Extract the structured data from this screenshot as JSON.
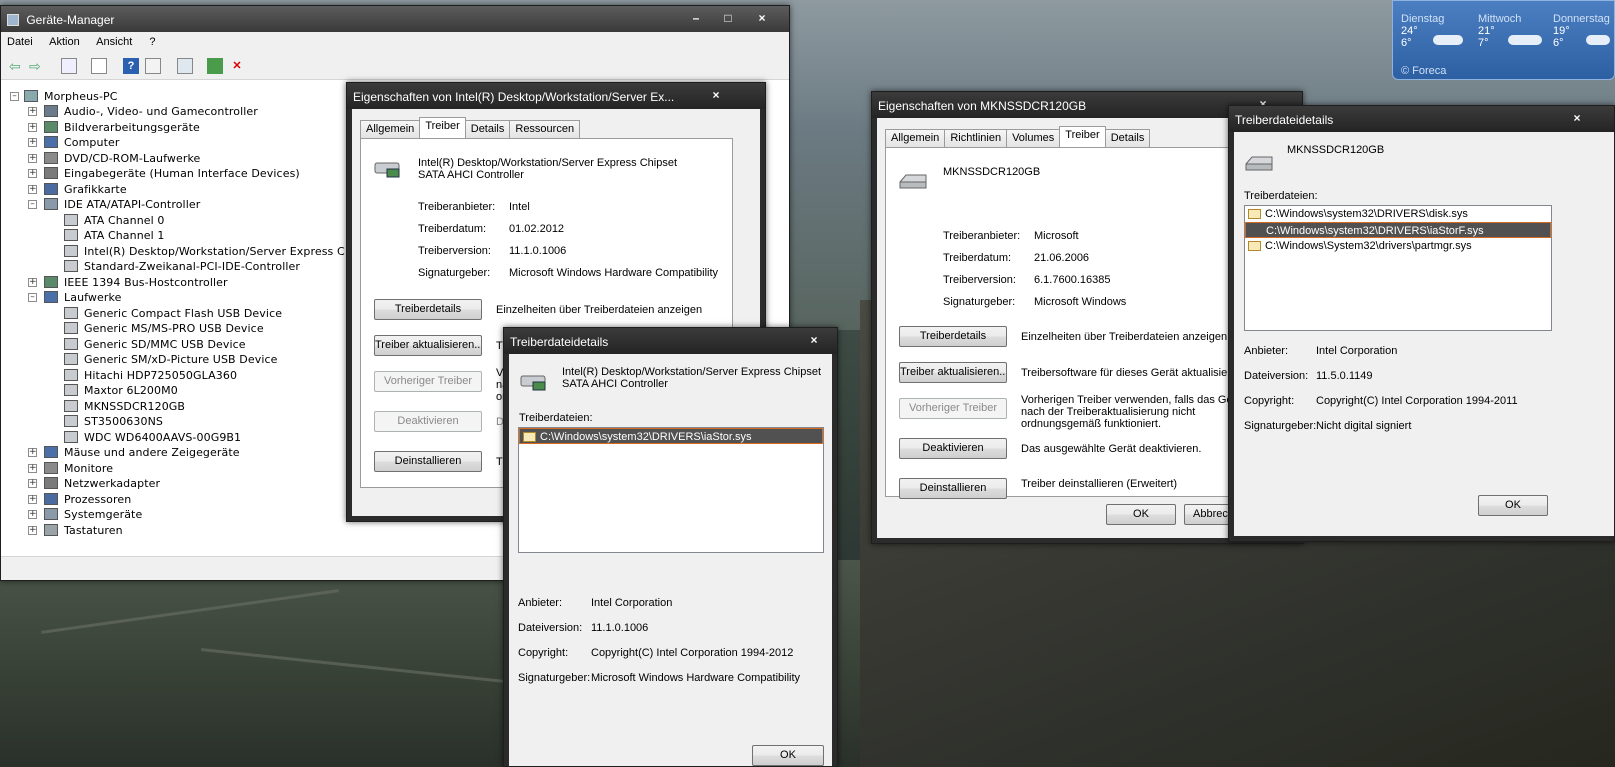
{
  "device_manager": {
    "title": "Geräte-Manager",
    "menu": [
      "Datei",
      "Aktion",
      "Ansicht",
      "?"
    ],
    "tree": {
      "root": "Morpheus-PC",
      "items": [
        {
          "label": "Audio-, Video- und Gamecontroller",
          "expanded": false
        },
        {
          "label": "Bildverarbeitungsgeräte",
          "expanded": false
        },
        {
          "label": "Computer",
          "expanded": false
        },
        {
          "label": "DVD/CD-ROM-Laufwerke",
          "expanded": false
        },
        {
          "label": "Eingabegeräte (Human Interface Devices)",
          "expanded": false
        },
        {
          "label": "Grafikkarte",
          "expanded": false
        },
        {
          "label": "IDE ATA/ATAPI-Controller",
          "expanded": true
        },
        {
          "label": "ATA Channel 0",
          "child": true
        },
        {
          "label": "ATA Channel 1",
          "child": true
        },
        {
          "label": "Intel(R) Desktop/Workstation/Server Express C",
          "child": true
        },
        {
          "label": "Standard-Zweikanal-PCI-IDE-Controller",
          "child": true
        },
        {
          "label": "IEEE 1394 Bus-Hostcontroller",
          "expanded": false
        },
        {
          "label": "Laufwerke",
          "expanded": true
        },
        {
          "label": "Generic Compact Flash USB Device",
          "child": true
        },
        {
          "label": "Generic MS/MS-PRO USB Device",
          "child": true
        },
        {
          "label": "Generic SD/MMC USB Device",
          "child": true
        },
        {
          "label": "Generic SM/xD-Picture USB Device",
          "child": true
        },
        {
          "label": "Hitachi HDP725050GLA360",
          "child": true
        },
        {
          "label": "Maxtor 6L200M0",
          "child": true
        },
        {
          "label": "MKNSSDCR120GB",
          "child": true
        },
        {
          "label": "ST3500630NS",
          "child": true
        },
        {
          "label": "WDC WD6400AAVS-00G9B1",
          "child": true
        },
        {
          "label": "Mäuse und andere Zeigegeräte",
          "expanded": false
        },
        {
          "label": "Monitore",
          "expanded": false
        },
        {
          "label": "Netzwerkadapter",
          "expanded": false
        },
        {
          "label": "Prozessoren",
          "expanded": false
        },
        {
          "label": "Systemgeräte",
          "expanded": false
        },
        {
          "label": "Tastaturen",
          "expanded": false
        }
      ]
    }
  },
  "intel_props": {
    "title": "Eigenschaften von Intel(R) Desktop/Workstation/Server Ex...",
    "tabs": [
      "Allgemein",
      "Treiber",
      "Details",
      "Ressourcen"
    ],
    "device_line1": "Intel(R) Desktop/Workstation/Server Express Chipset",
    "device_line2": "SATA AHCI Controller",
    "fields": [
      {
        "label": "Treiberanbieter:",
        "value": "Intel"
      },
      {
        "label": "Treiberdatum:",
        "value": "01.02.2012"
      },
      {
        "label": "Treiberversion:",
        "value": "11.1.0.1006"
      },
      {
        "label": "Signaturgeber:",
        "value": "Microsoft Windows Hardware Compatibility"
      }
    ],
    "buttons": [
      {
        "label": "Treiberdetails",
        "desc": "Einzelheiten über Treiberdateien anzeigen",
        "disabled": false
      },
      {
        "label": "Treiber aktualisieren...",
        "desc": "Tr",
        "disabled": false
      },
      {
        "label": "Vorheriger Treiber",
        "desc": "Vo",
        "disabled": true
      },
      {
        "label": "Deaktivieren",
        "desc": "D",
        "disabled": true
      },
      {
        "label": "Deinstallieren",
        "desc": "Tr",
        "disabled": false
      }
    ],
    "partial_text": [
      "nac",
      "or"
    ]
  },
  "intel_details": {
    "title": "Treiberdateidetails",
    "device_line1": "Intel(R) Desktop/Workstation/Server Express Chipset",
    "device_line2": "SATA AHCI Controller",
    "files_label": "Treiberdateien:",
    "files": [
      "C:\\Windows\\system32\\DRIVERS\\iaStor.sys"
    ],
    "fields": [
      {
        "label": "Anbieter:",
        "value": "Intel Corporation"
      },
      {
        "label": "Dateiversion:",
        "value": "11.1.0.1006"
      },
      {
        "label": "Copyright:",
        "value": "Copyright(C) Intel Corporation 1994-2012"
      },
      {
        "label": "Signaturgeber:",
        "value": "Microsoft Windows Hardware Compatibility"
      }
    ],
    "ok": "OK"
  },
  "mkn_props": {
    "title": "Eigenschaften von MKNSSDCR120GB",
    "tabs": [
      "Allgemein",
      "Richtlinien",
      "Volumes",
      "Treiber",
      "Details"
    ],
    "device": "MKNSSDCR120GB",
    "fields": [
      {
        "label": "Treiberanbieter:",
        "value": "Microsoft"
      },
      {
        "label": "Treiberdatum:",
        "value": "21.06.2006"
      },
      {
        "label": "Treiberversion:",
        "value": "6.1.7600.16385"
      },
      {
        "label": "Signaturgeber:",
        "value": "Microsoft Windows"
      }
    ],
    "buttons": [
      {
        "label": "Treiberdetails",
        "desc": "Einzelheiten über Treiberdateien anzeigen",
        "disabled": false
      },
      {
        "label": "Treiber aktualisieren...",
        "desc": "Treibersoftware für dieses Gerät aktualisieren",
        "disabled": false
      },
      {
        "label": "Vorheriger Treiber",
        "desc": "Vorherigen Treiber verwenden, falls das Gerät nach der Treiberaktualisierung nicht ordnungsgemäß funktioniert.",
        "disabled": true
      },
      {
        "label": "Deaktivieren",
        "desc": "Das ausgewählte Gerät deaktivieren.",
        "disabled": false
      },
      {
        "label": "Deinstallieren",
        "desc": "Treiber deinstallieren (Erweitert)",
        "disabled": false
      }
    ],
    "ok": "OK",
    "cancel": "Abbrec"
  },
  "mkn_details": {
    "title": "Treiberdateidetails",
    "device": "MKNSSDCR120GB",
    "files_label": "Treiberdateien:",
    "files": [
      "C:\\Windows\\system32\\DRIVERS\\disk.sys",
      "C:\\Windows\\system32\\DRIVERS\\iaStorF.sys",
      "C:\\Windows\\System32\\drivers\\partmgr.sys"
    ],
    "selected_index": 1,
    "fields": [
      {
        "label": "Anbieter:",
        "value": "Intel Corporation"
      },
      {
        "label": "Dateiversion:",
        "value": "11.5.0.1149"
      },
      {
        "label": "Copyright:",
        "value": "Copyright(C) Intel Corporation 1994-2011"
      },
      {
        "label": "Signaturgeber:",
        "value": "Nicht digital signiert"
      }
    ],
    "ok": "OK"
  },
  "weather": {
    "days": [
      {
        "name": "Dienstag",
        "high": "24°",
        "low": "6°"
      },
      {
        "name": "Mittwoch",
        "high": "21°",
        "low": "7°"
      },
      {
        "name": "Donnerstag",
        "high": "19°",
        "low": "6°"
      }
    ],
    "source": "© Foreca"
  }
}
